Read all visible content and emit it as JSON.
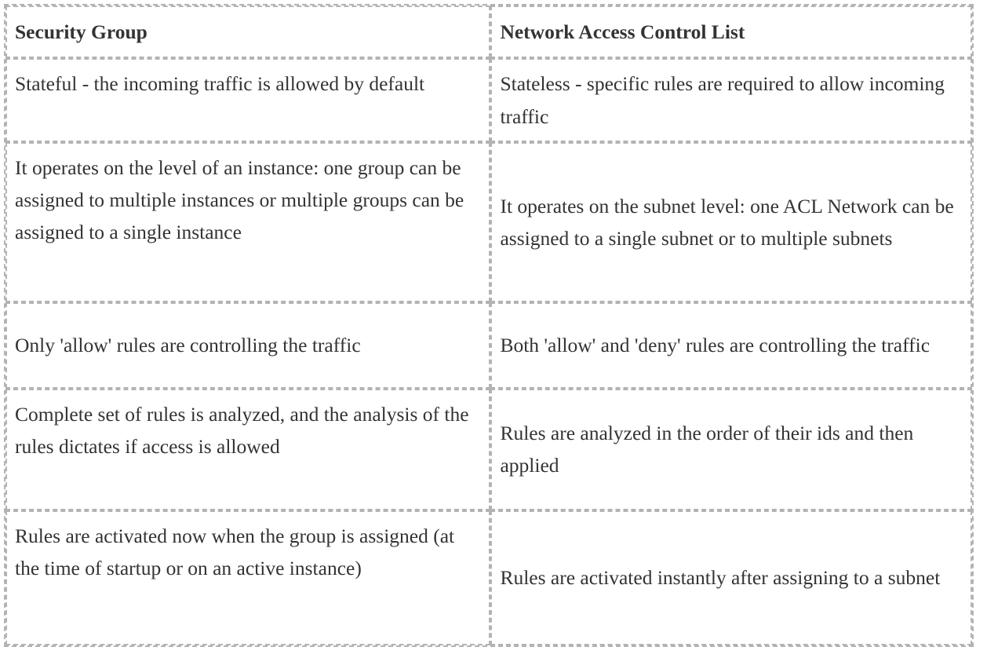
{
  "table": {
    "columns": [
      {
        "header": "Security Group"
      },
      {
        "header": "Network Access Control List"
      }
    ],
    "rows": [
      {
        "security_group": "Stateful - the incoming traffic is allowed by default",
        "network_acl": "Stateless - specific rules are required to allow incoming traffic"
      },
      {
        "security_group": "It operates on the level of an instance: one group can be assigned to multiple instances or multiple groups can be assigned to a single instance",
        "network_acl": "It operates on the subnet level: one ACL Network can be assigned to a single subnet or to multiple subnets"
      },
      {
        "security_group": "Only 'allow' rules are controlling the traffic",
        "network_acl": "Both 'allow' and 'deny' rules are controlling the traffic"
      },
      {
        "security_group": "Complete set of rules is analyzed, and the analysis of the rules dictates if access is allowed",
        "network_acl": "Rules are analyzed in the order of their ids and then applied"
      },
      {
        "security_group": "Rules are activated now when the group is assigned (at the time of startup or on an active instance)",
        "network_acl": "Rules are activated instantly after assigning to a subnet"
      }
    ]
  },
  "style": {
    "text_color": "#333333",
    "border_color": "#b3b3b3",
    "background_color": "#ffffff"
  }
}
